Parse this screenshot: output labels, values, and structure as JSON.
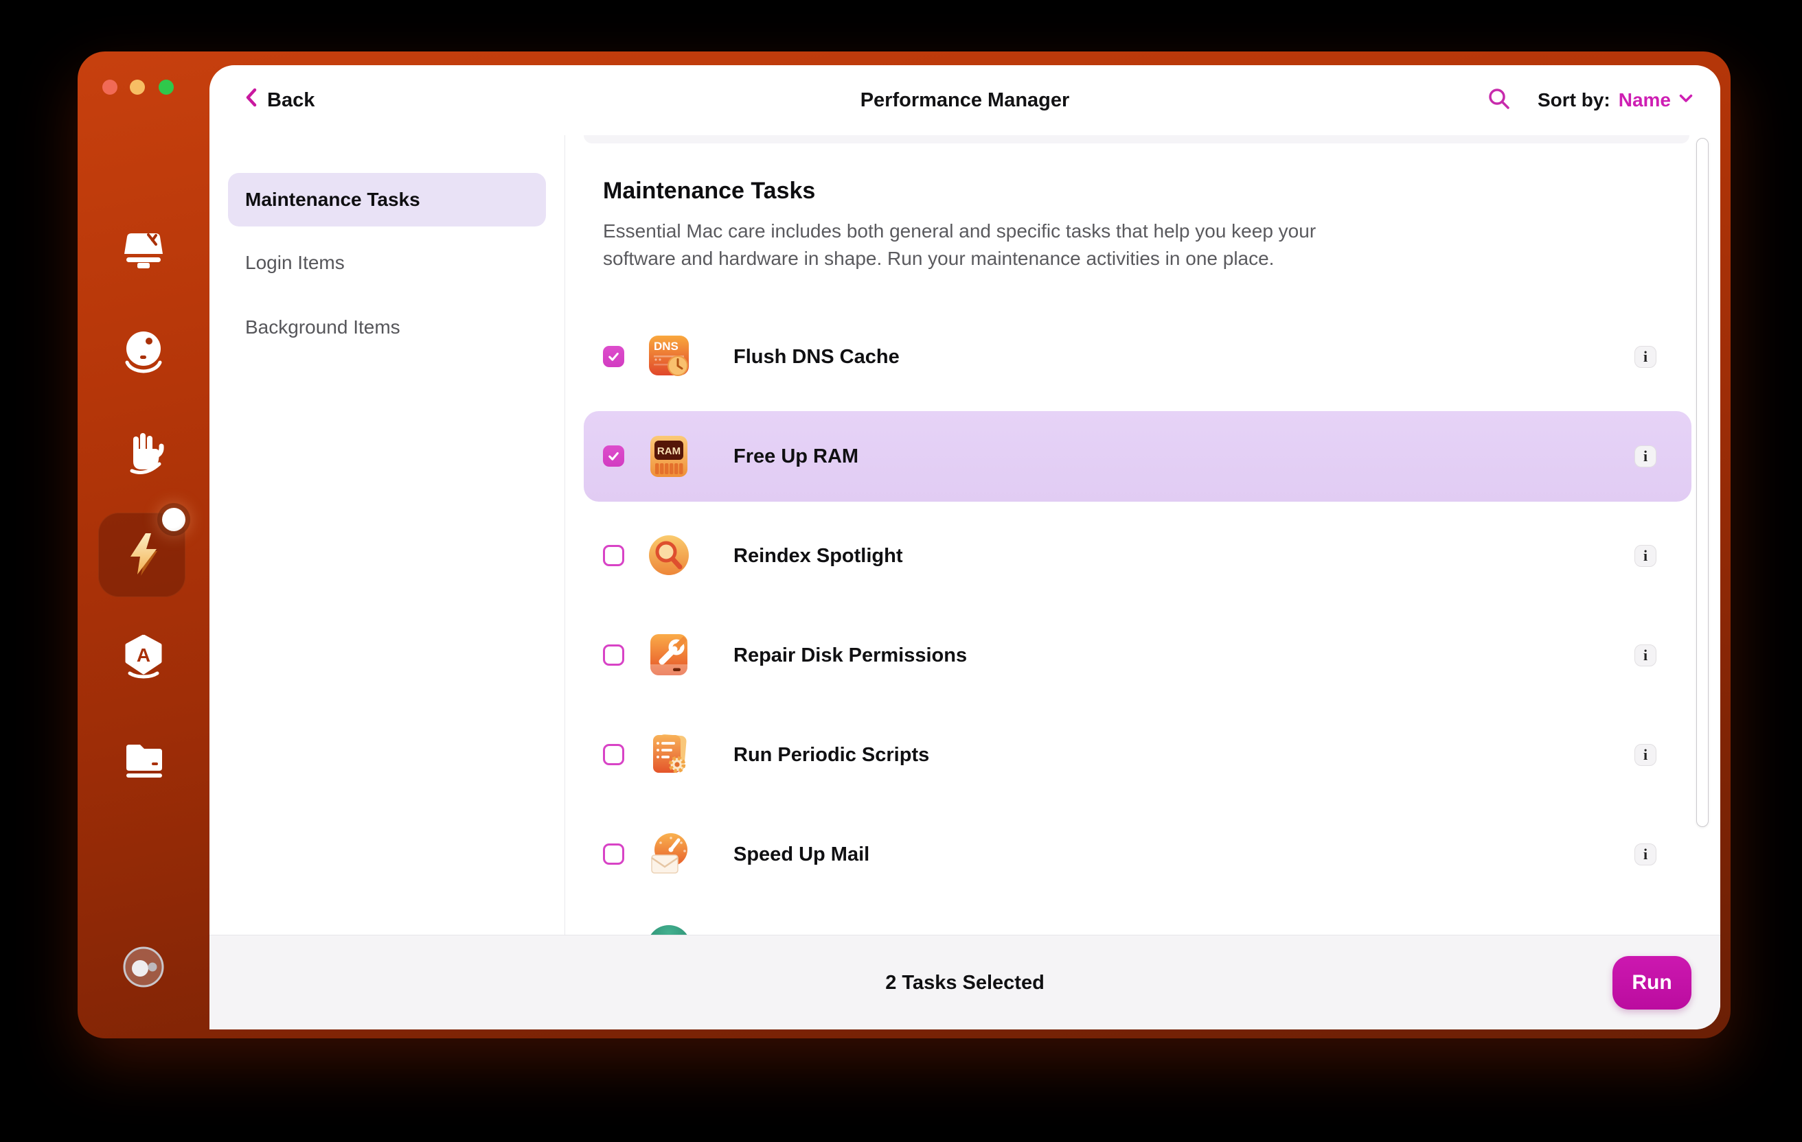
{
  "header": {
    "back_label": "Back",
    "title": "Performance Manager",
    "sort_by_label": "Sort by:",
    "sort_value": "Name"
  },
  "window_controls": [
    "close",
    "minimize",
    "zoom"
  ],
  "sidebar": {
    "icons": [
      {
        "name": "cleanup-icon"
      },
      {
        "name": "protection-icon"
      },
      {
        "name": "privacy-hand-icon"
      },
      {
        "name": "performance-bolt-icon",
        "active": true,
        "badge": true
      },
      {
        "name": "applications-icon"
      },
      {
        "name": "folder-icon"
      },
      {
        "name": "assistant-icon"
      }
    ]
  },
  "nav": {
    "items": [
      {
        "label": "Maintenance Tasks",
        "selected": true
      },
      {
        "label": "Login Items",
        "selected": false
      },
      {
        "label": "Background Items",
        "selected": false
      }
    ]
  },
  "content": {
    "title": "Maintenance Tasks",
    "description": "Essential Mac care includes both general and specific tasks that help you keep your\nsoftware and hardware in shape. Run your maintenance activities in one place.",
    "info_glyph": "i",
    "tasks": [
      {
        "label": "Flush DNS Cache",
        "checked": true,
        "highlighted": false,
        "icon": "flush-dns-icon"
      },
      {
        "label": "Free Up RAM",
        "checked": true,
        "highlighted": true,
        "icon": "free-up-ram-icon"
      },
      {
        "label": "Reindex Spotlight",
        "checked": false,
        "highlighted": false,
        "icon": "reindex-spotlight-icon"
      },
      {
        "label": "Repair Disk Permissions",
        "checked": false,
        "highlighted": false,
        "icon": "repair-disk-icon"
      },
      {
        "label": "Run Periodic Scripts",
        "checked": false,
        "highlighted": false,
        "icon": "periodic-scripts-icon"
      },
      {
        "label": "Speed Up Mail",
        "checked": false,
        "highlighted": false,
        "icon": "speed-up-mail-icon"
      }
    ]
  },
  "footer": {
    "status": "2 Tasks Selected",
    "run_label": "Run"
  },
  "colors": {
    "accent": "#CE1FB3",
    "checkbox": "#D843C6",
    "nav_selected_bg": "#E9E2F6",
    "highlight_row": "#E3CFF5",
    "footer_bg": "#F5F4F6",
    "run_button": "#C414AA",
    "sidebar_top": "#C7400E",
    "sidebar_bottom": "#6B1F05"
  }
}
